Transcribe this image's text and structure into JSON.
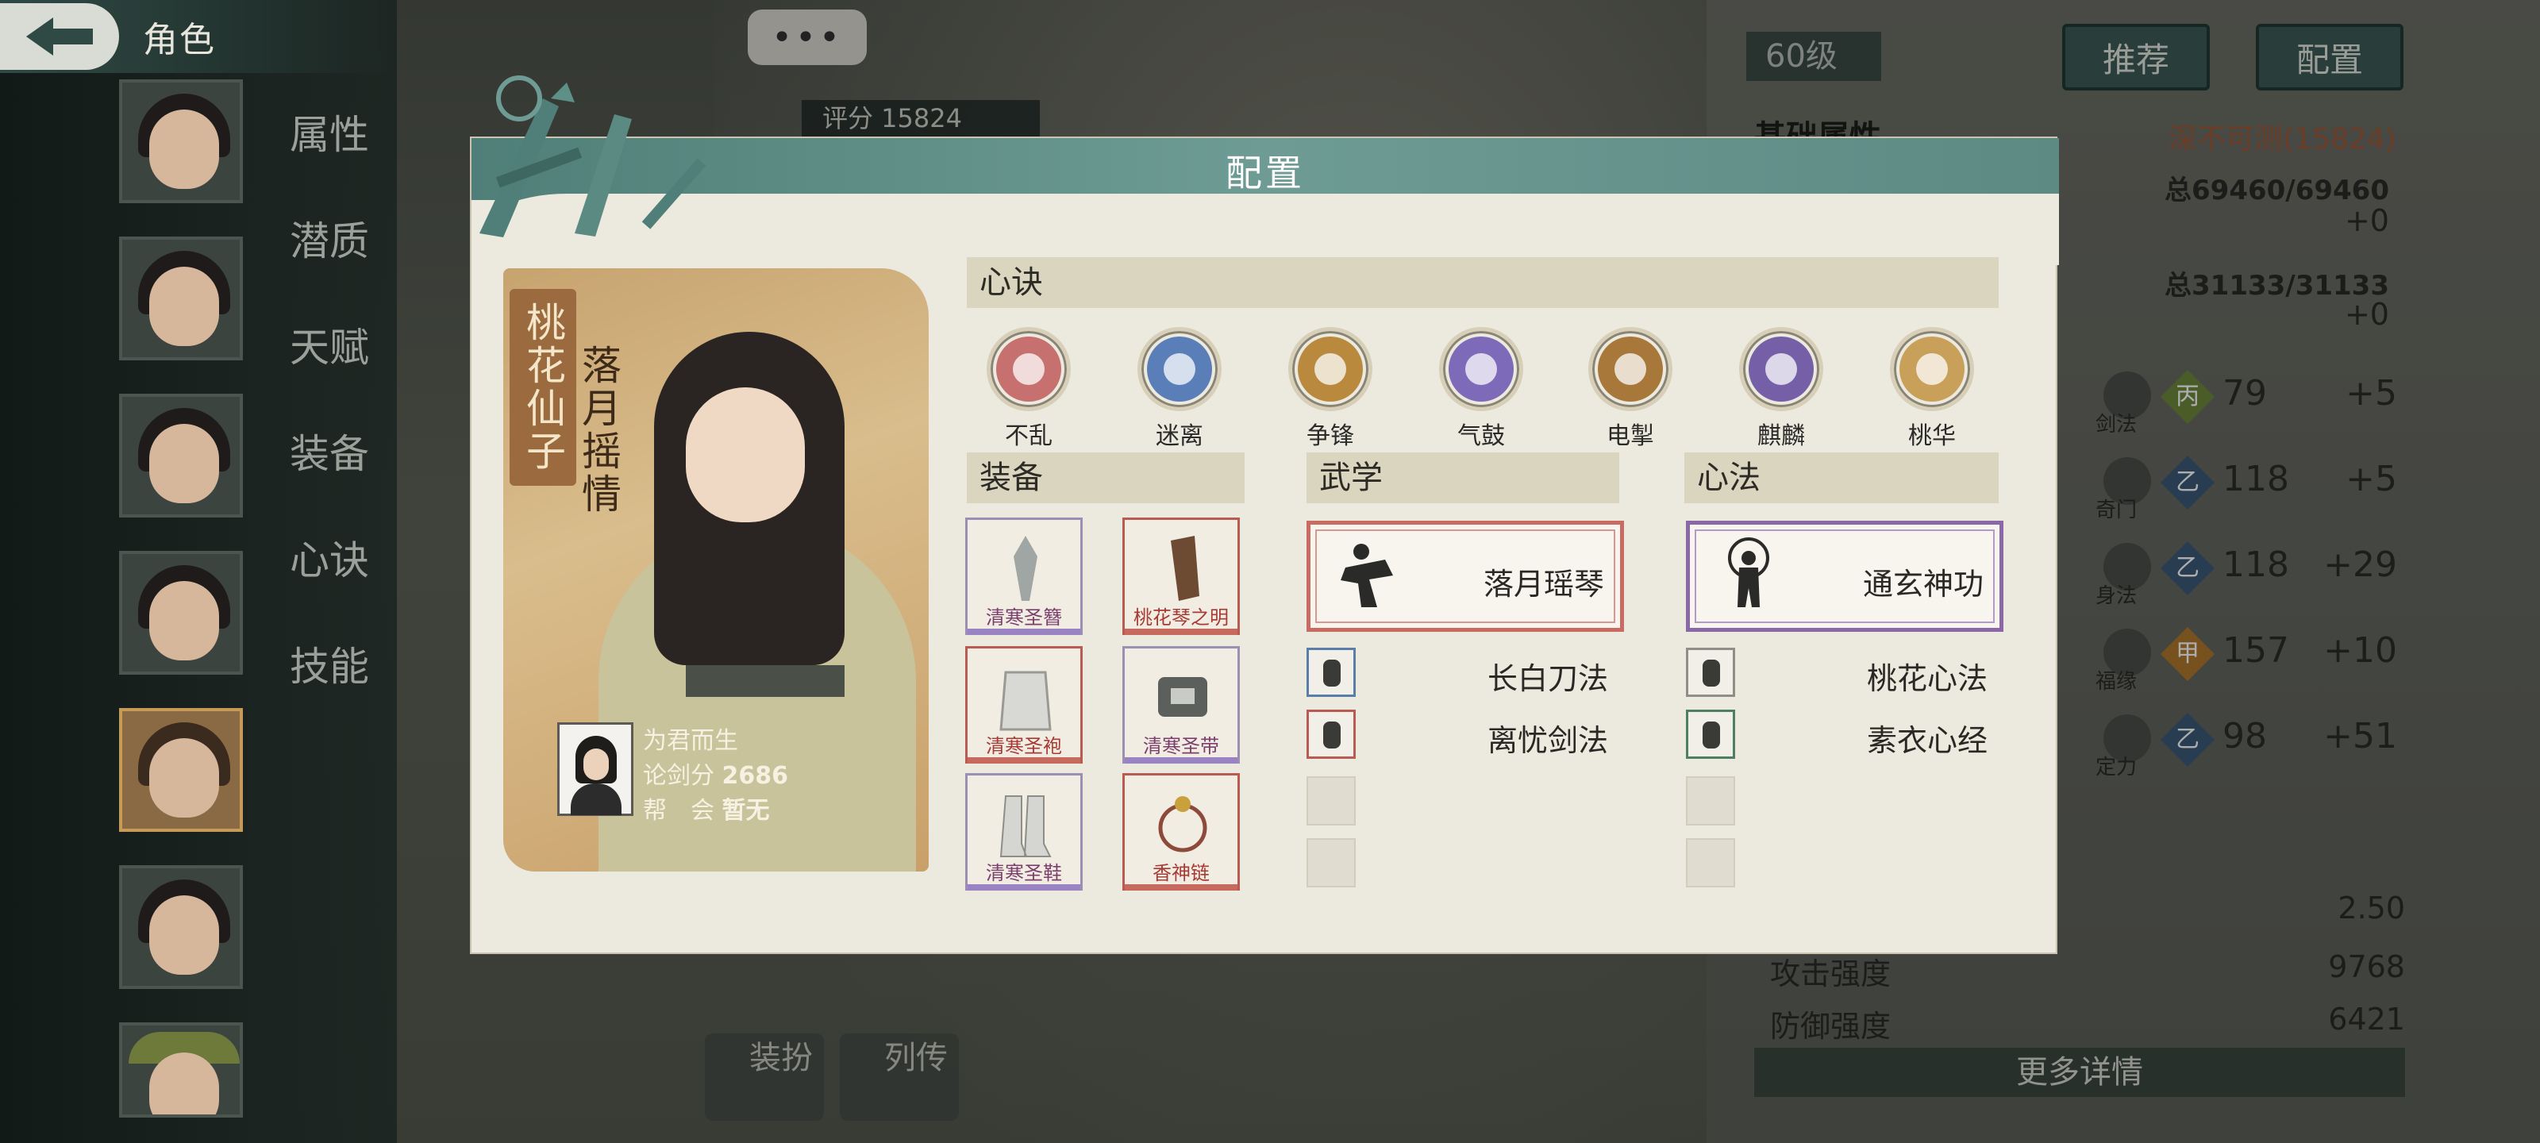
{
  "topbar": {
    "title": "角色"
  },
  "more_button": "•••",
  "score_label": "评分 15824",
  "side_menu": [
    "属性",
    "潜质",
    "天赋",
    "装备",
    "心诀",
    "技能"
  ],
  "right_panel": {
    "level": "60级",
    "recommend": "推荐",
    "config": "配置",
    "basic_attr_title": "基础属性",
    "rank": "深不可测(15824)",
    "total1": "总69460/69460",
    "plus1": "+0",
    "total2": "总31133/31133",
    "plus2": "+0",
    "attrs": [
      {
        "name": "剑法",
        "grade": "丙",
        "value": "79",
        "add": "+5",
        "color": "#6d8a3c"
      },
      {
        "name": "奇门",
        "grade": "乙",
        "value": "118",
        "add": "+5",
        "color": "#3d5a7a"
      },
      {
        "name": "身法",
        "grade": "乙",
        "value": "118",
        "add": "+29",
        "color": "#3d5a7a"
      },
      {
        "name": "福缘",
        "grade": "甲",
        "value": "157",
        "add": "+10",
        "color": "#b07a2e"
      },
      {
        "name": "定力",
        "grade": "乙",
        "value": "98",
        "add": "+51",
        "color": "#3d5a7a"
      }
    ],
    "bottom_stats": [
      {
        "label": "",
        "value": "2.50"
      },
      {
        "label": "攻击强度",
        "value": "9768"
      },
      {
        "label": "防御强度",
        "value": "6421"
      }
    ],
    "more_details": "更多详情"
  },
  "bottom_buttons": [
    "装扮",
    "列传"
  ],
  "modal": {
    "title": "配置",
    "portrait": {
      "title_vertical": "桃花仙子",
      "name_vertical": "落月摇情",
      "player_name": "为君而生",
      "sword_score_label": "论剑分",
      "sword_score": "2686",
      "guild_label": "帮　会",
      "guild": "暂无"
    },
    "heart": {
      "title": "心诀",
      "skills": [
        {
          "name": "不乱",
          "color": "#c77070"
        },
        {
          "name": "迷离",
          "color": "#5a7fb8"
        },
        {
          "name": "争锋",
          "color": "#b98a3e"
        },
        {
          "name": "气鼓",
          "color": "#7d6ab8"
        },
        {
          "name": "电掣",
          "color": "#a8783a"
        },
        {
          "name": "麒麟",
          "color": "#7560a8"
        },
        {
          "name": "桃华",
          "color": "#c9a05a"
        }
      ]
    },
    "equipment": {
      "title": "装备",
      "items": [
        {
          "name": "清寒圣簪",
          "tier": "purple"
        },
        {
          "name": "桃花琴之明",
          "tier": "red"
        },
        {
          "name": "清寒圣袍",
          "tier": "red"
        },
        {
          "name": "清寒圣带",
          "tier": "purple"
        },
        {
          "name": "清寒圣鞋",
          "tier": "purple"
        },
        {
          "name": "香神链",
          "tier": "red"
        }
      ]
    },
    "martial": {
      "title": "武学",
      "main": "落月瑶琴",
      "subs": [
        "长白刀法",
        "离忧剑法"
      ]
    },
    "mind": {
      "title": "心法",
      "main": "通玄神功",
      "subs": [
        "桃花心法",
        "素衣心经"
      ]
    }
  }
}
